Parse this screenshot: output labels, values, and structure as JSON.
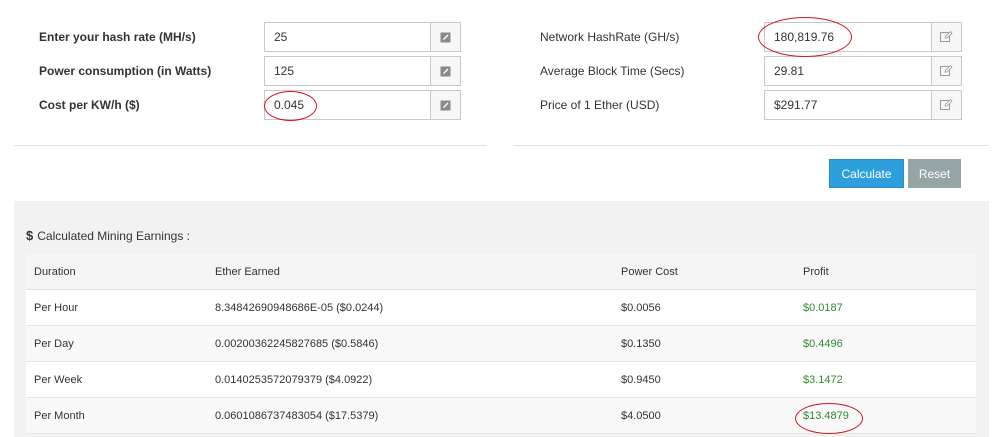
{
  "left_form": {
    "rows": [
      {
        "label": "Enter your hash rate (MH/s)",
        "value": "25"
      },
      {
        "label": "Power consumption (in Watts)",
        "value": "125"
      },
      {
        "label": "Cost per KW/h ($)",
        "value": "0.045"
      }
    ]
  },
  "right_form": {
    "rows": [
      {
        "label": "Network HashRate (GH/s)",
        "value": "180,819.76"
      },
      {
        "label": "Average Block Time (Secs)",
        "value": "29.81"
      },
      {
        "label": "Price of 1 Ether (USD)",
        "value": "$291.77"
      }
    ]
  },
  "buttons": {
    "calculate": "Calculate",
    "reset": "Reset"
  },
  "results": {
    "currency_symbol": "$",
    "title": "Calculated Mining Earnings :",
    "columns": [
      "Duration",
      "Ether Earned",
      "Power Cost",
      "Profit"
    ],
    "rows": [
      {
        "duration": "Per Hour",
        "ether": "8.34842690948686E-05 ($0.0244)",
        "power": "$0.0056",
        "profit": "$0.0187"
      },
      {
        "duration": "Per Day",
        "ether": "0.00200362245827685 ($0.5846)",
        "power": "$0.1350",
        "profit": "$0.4496"
      },
      {
        "duration": "Per Week",
        "ether": "0.0140253572079379 ($4.0922)",
        "power": "$0.9450",
        "profit": "$3.1472"
      },
      {
        "duration": "Per Month",
        "ether": "0.0601086737483054 ($17.5379)",
        "power": "$4.0500",
        "profit": "$13.4879"
      }
    ]
  },
  "colors": {
    "accent": "#2d9fdc",
    "profit": "#2e8b2e",
    "annotation": "#d0151c"
  }
}
